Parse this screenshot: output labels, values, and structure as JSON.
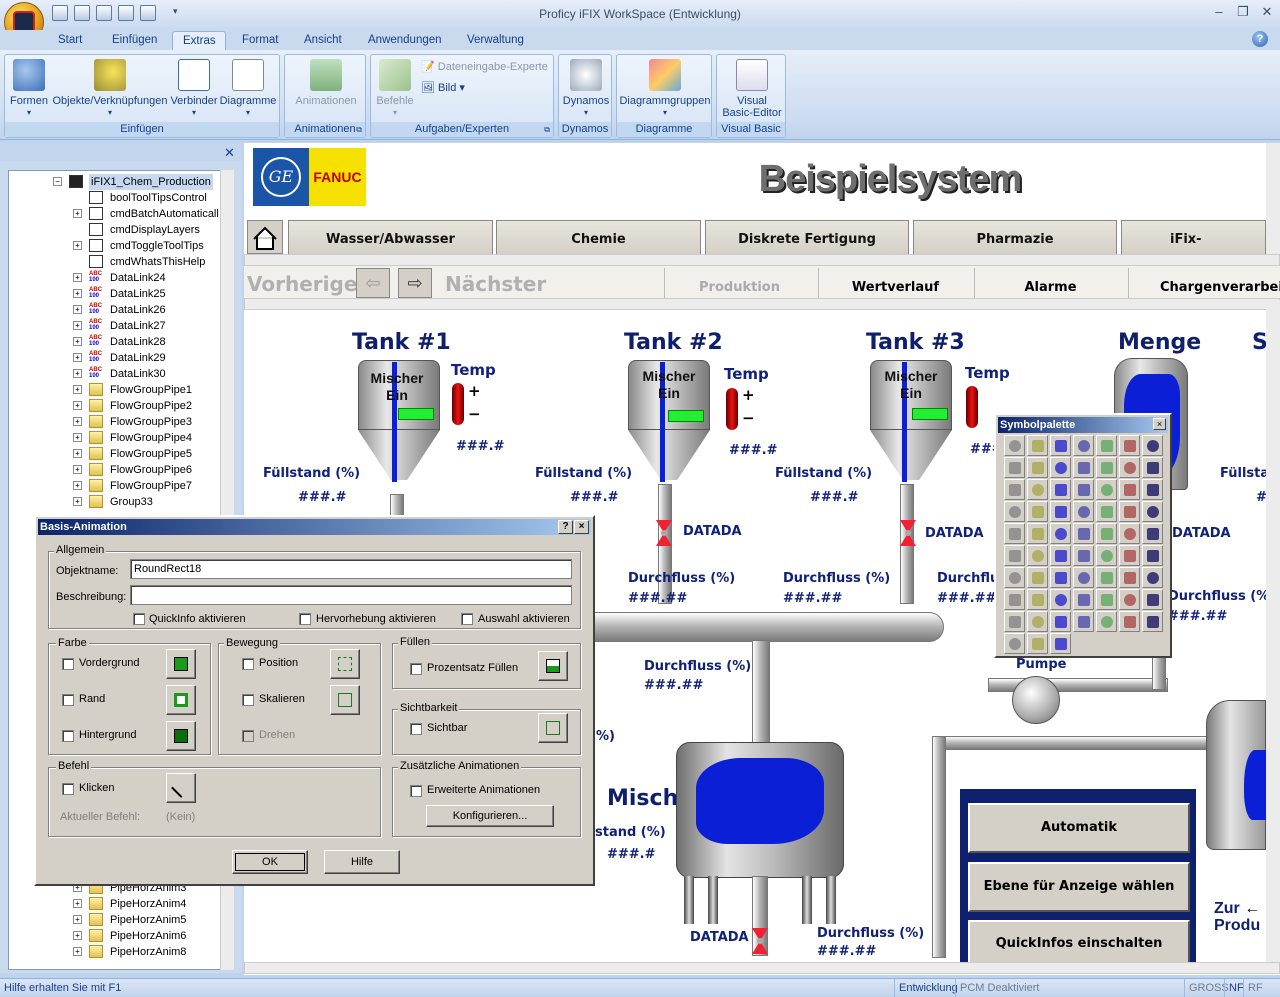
{
  "window": {
    "title": "Proficy iFIX WorkSpace (Entwicklung)"
  },
  "ribbon": {
    "tabs": [
      "Start",
      "Einfügen",
      "Extras",
      "Format",
      "Ansicht",
      "Anwendungen",
      "Verwaltung"
    ],
    "active_tab": "Extras",
    "groups": {
      "einfuegen": {
        "label": "Einfügen",
        "buttons": [
          "Formen",
          "Objekte/Verknüpfungen",
          "Verbinder",
          "Diagramme"
        ]
      },
      "animationen": {
        "label": "Animationen",
        "buttons": [
          "Animationen"
        ]
      },
      "aufgaben": {
        "label": "Aufgaben/Experten",
        "buttons": [
          "Befehle"
        ],
        "small": [
          "Dateneingabe-Experte",
          "Bild"
        ]
      },
      "dynamos": {
        "label": "Dynamos",
        "buttons": [
          "Dynamos"
        ]
      },
      "diagramme": {
        "label": "Diagramme",
        "buttons": [
          "Diagrammgruppen"
        ]
      },
      "vb": {
        "label": "Visual Basic",
        "button_line1": "Visual",
        "button_line2": "Basic-Editor"
      }
    }
  },
  "tree": {
    "root": "iFIX1_Chem_Production",
    "items": [
      "boolToolTipsControl",
      "cmdBatchAutomaticall",
      "cmdDisplayLayers",
      "cmdToggleToolTips",
      "cmdWhatsThisHelp",
      "DataLink24",
      "DataLink25",
      "DataLink26",
      "DataLink27",
      "DataLink28",
      "DataLink29",
      "DataLink30",
      "FlowGroupPipe1",
      "FlowGroupPipe2",
      "FlowGroupPipe3",
      "FlowGroupPipe4",
      "FlowGroupPipe5",
      "FlowGroupPipe6",
      "FlowGroupPipe7",
      "Group33"
    ],
    "bottom_items": [
      "PipeHorzAnim3",
      "PipeHorzAnim4",
      "PipeHorzAnim5",
      "PipeHorzAnim6",
      "PipeHorzAnim8"
    ],
    "abc_top": "ABC",
    "abc_bottom": "100"
  },
  "display": {
    "banner_title": "Beispielsystem",
    "fanuc": "FANUC",
    "ge": "GE",
    "nav_tabs": [
      "Wasser/Abwasser",
      "Chemie",
      "Diskrete Fertigung",
      "Pharmazie",
      "iFix-Technolog"
    ],
    "prev": "Vorheriger",
    "next": "Nächster",
    "sub_tabs": [
      "Produktion",
      "Wertverlauf",
      "Alarme",
      "Chargenverarbei"
    ],
    "tank1": "Tank #1",
    "tank2": "Tank #2",
    "tank3": "Tank #3",
    "menge": "Menge",
    "s": "S",
    "mischer_line1": "Mischer",
    "mischer_line2": "Ein",
    "temp": "Temp",
    "hash1": "###.#",
    "hash2": "###.##",
    "fuellstand": "Füllstand (%)",
    "fuellstand_cut": "Füllstan",
    "fuellstand_left": "stand (%)",
    "datada": "DATADA",
    "durchfluss": "Durchfluss (%)",
    "durchfluss_cut": "Durchflus",
    "pct_cut": "%)",
    "mischer_big": "Mischer",
    "pumpe": "Pumpe",
    "automatik": "Automatik",
    "ebene": "Ebene für Anzeige wählen",
    "quickinfos": "QuickInfos einschalten",
    "zur": "Zur",
    "produ": "Produ",
    "plus": "+",
    "minus": "−",
    "hash_cut": "###",
    "hash_d": "###.##"
  },
  "palette": {
    "title": "Symbolpalette"
  },
  "dialog": {
    "title": "Basis-Animation",
    "allgemein": "Allgemein",
    "objektname_label": "Objektname:",
    "objektname_value": "RoundRect18",
    "beschreibung_label": "Beschreibung:",
    "beschreibung_value": "",
    "quickinfo": "QuickInfo aktivieren",
    "hervorhebung": "Hervorhebung aktivieren",
    "auswahl": "Auswahl aktivieren",
    "farbe": "Farbe",
    "vordergrund": "Vordergrund",
    "rand": "Rand",
    "hintergrund": "Hintergrund",
    "bewegung": "Bewegung",
    "position": "Position",
    "skalieren": "Skalieren",
    "drehen": "Drehen",
    "fuellen": "Füllen",
    "prozentsatz": "Prozentsatz Füllen",
    "sichtbarkeit": "Sichtbarkeit",
    "sichtbar": "Sichtbar",
    "befehl": "Befehl",
    "klicken": "Klicken",
    "aktueller_befehl": "Aktueller Befehl:",
    "kein": "(Kein)",
    "zusaetzliche": "Zusätzliche Animationen",
    "erweiterte": "Erweiterte Animationen",
    "konfigurieren": "Konfigurieren...",
    "ok": "OK",
    "hilfe": "Hilfe",
    "help_btn": "?",
    "close_btn": "×"
  },
  "statusbar": {
    "left": "Hilfe erhalten Sie mit F1",
    "mode": "Entwicklung",
    "pcm": "PCM Deaktiviert",
    "caps": "GROSS",
    "nf": "NF",
    "rf": "RF"
  },
  "colors": {
    "tank_blue": "#0b1fd6",
    "label_navy": "#10217a",
    "dialog_title": "#0a246a"
  }
}
